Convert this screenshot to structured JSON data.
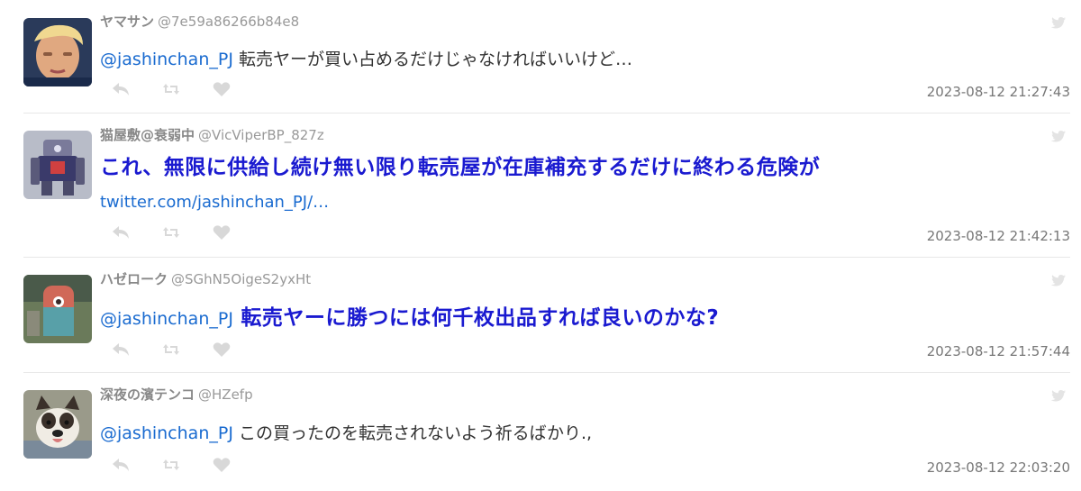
{
  "tweets": [
    {
      "name": "ヤマサン",
      "handle": "@7e59a86266b84e8",
      "mention": "@jashinchan_PJ",
      "text": " 転売ヤーが買い占めるだけじゃなければいいけど…",
      "link": "",
      "timestamp": "2023-08-12 21:27:43",
      "avatar_color": "#c9a07a"
    },
    {
      "name": "猫屋敷@衰弱中",
      "handle": "@VicViperBP_827z",
      "mention": "",
      "text": "これ、無限に供給し続け無い限り転売屋が在庫補充するだけに終わる危険が",
      "link": "twitter.com/jashinchan_PJ/…",
      "timestamp": "2023-08-12 21:42:13",
      "avatar_color": "#6a6a8a"
    },
    {
      "name": "ハゼローク",
      "handle": "@SGhN5OigeS2yxHt",
      "mention": "@jashinchan_PJ",
      "text": " 転売ヤーに勝つには何千枚出品すれば良いのかな?",
      "link": "",
      "timestamp": "2023-08-12 21:57:44",
      "avatar_color": "#5aa0a0"
    },
    {
      "name": "深夜の濱テンコ",
      "handle": "@HZefp",
      "mention": "@jashinchan_PJ",
      "text": " この買ったのを転売されないよう祈るばかり.,",
      "link": "",
      "timestamp": "2023-08-12 22:03:20",
      "avatar_color": "#8a7a6a"
    }
  ],
  "icons": {
    "reply": "reply-icon",
    "retweet": "retweet-icon",
    "like": "heart-icon",
    "bird": "twitter-bird-icon"
  },
  "colors": {
    "mention": "#1a6bd0",
    "emphasis": "#1a1ad0",
    "icon": "#d8d8d8"
  }
}
